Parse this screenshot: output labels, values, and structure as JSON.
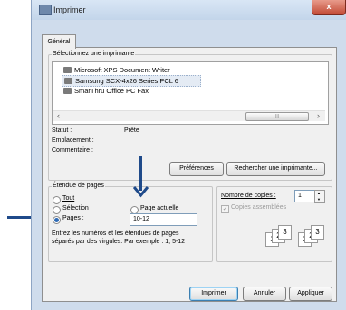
{
  "window": {
    "title": "Imprimer",
    "close_glyph": "x"
  },
  "tabs": [
    {
      "label": "Général"
    }
  ],
  "printer_select": {
    "label": "Sélectionnez une imprimante",
    "printers": [
      {
        "name": "Microsoft XPS Document Writer"
      },
      {
        "name": "Samsung SCX-4x26 Series PCL 6"
      },
      {
        "name": "SmarThru Office PC Fax"
      }
    ],
    "scroll_left": "‹",
    "scroll_right": "›",
    "scroll_thumb": "|||"
  },
  "status": {
    "statut_label": "Statut :",
    "statut_value": "Prête",
    "emplacement_label": "Emplacement :",
    "commentaire_label": "Commentaire :"
  },
  "buttons": {
    "preferences": "Préférences",
    "find_printer": "Rechercher une imprimante...",
    "print": "Imprimer",
    "cancel": "Annuler",
    "apply": "Appliquer"
  },
  "page_range": {
    "label": "Étendue de pages",
    "all": "Tout",
    "selection": "Sélection",
    "current_page": "Page actuelle",
    "pages": "Pages :",
    "pages_value": "10-12",
    "help_line1": "Entrez les numéros et les étendues de pages",
    "help_line2": "séparés par des virgules. Par exemple : 1, 5-12"
  },
  "copies": {
    "label": "Nombre de copies :",
    "value": "1",
    "collate": "Copies assemblées",
    "spin_up": "▲",
    "spin_down": "▼"
  },
  "collate_glyphs": [
    "1",
    "2",
    "3",
    "1",
    "2",
    "3"
  ]
}
